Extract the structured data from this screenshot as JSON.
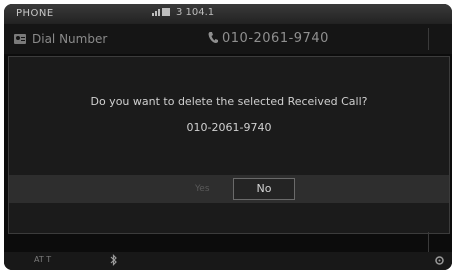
{
  "status_bar": {
    "title": "PHONE",
    "center_text": "3  104.1"
  },
  "dial_row": {
    "label": "Dial Number",
    "number": "010-2061-9740"
  },
  "dialog": {
    "message": "Do you want to delete the selected Received Call?",
    "number": "010-2061-9740",
    "yes_label": "Yes",
    "no_label": "No"
  },
  "bottom_bar": {
    "left_text": "AT T"
  },
  "icons": {
    "signal": "signal-icon",
    "person": "contact-icon",
    "phone": "phone-icon",
    "bluetooth": "bluetooth-icon",
    "settings": "gear-icon"
  },
  "colors": {
    "background": "#0c0c0c",
    "dialog": "#1b1b1b",
    "text": "#d0d0d0"
  }
}
